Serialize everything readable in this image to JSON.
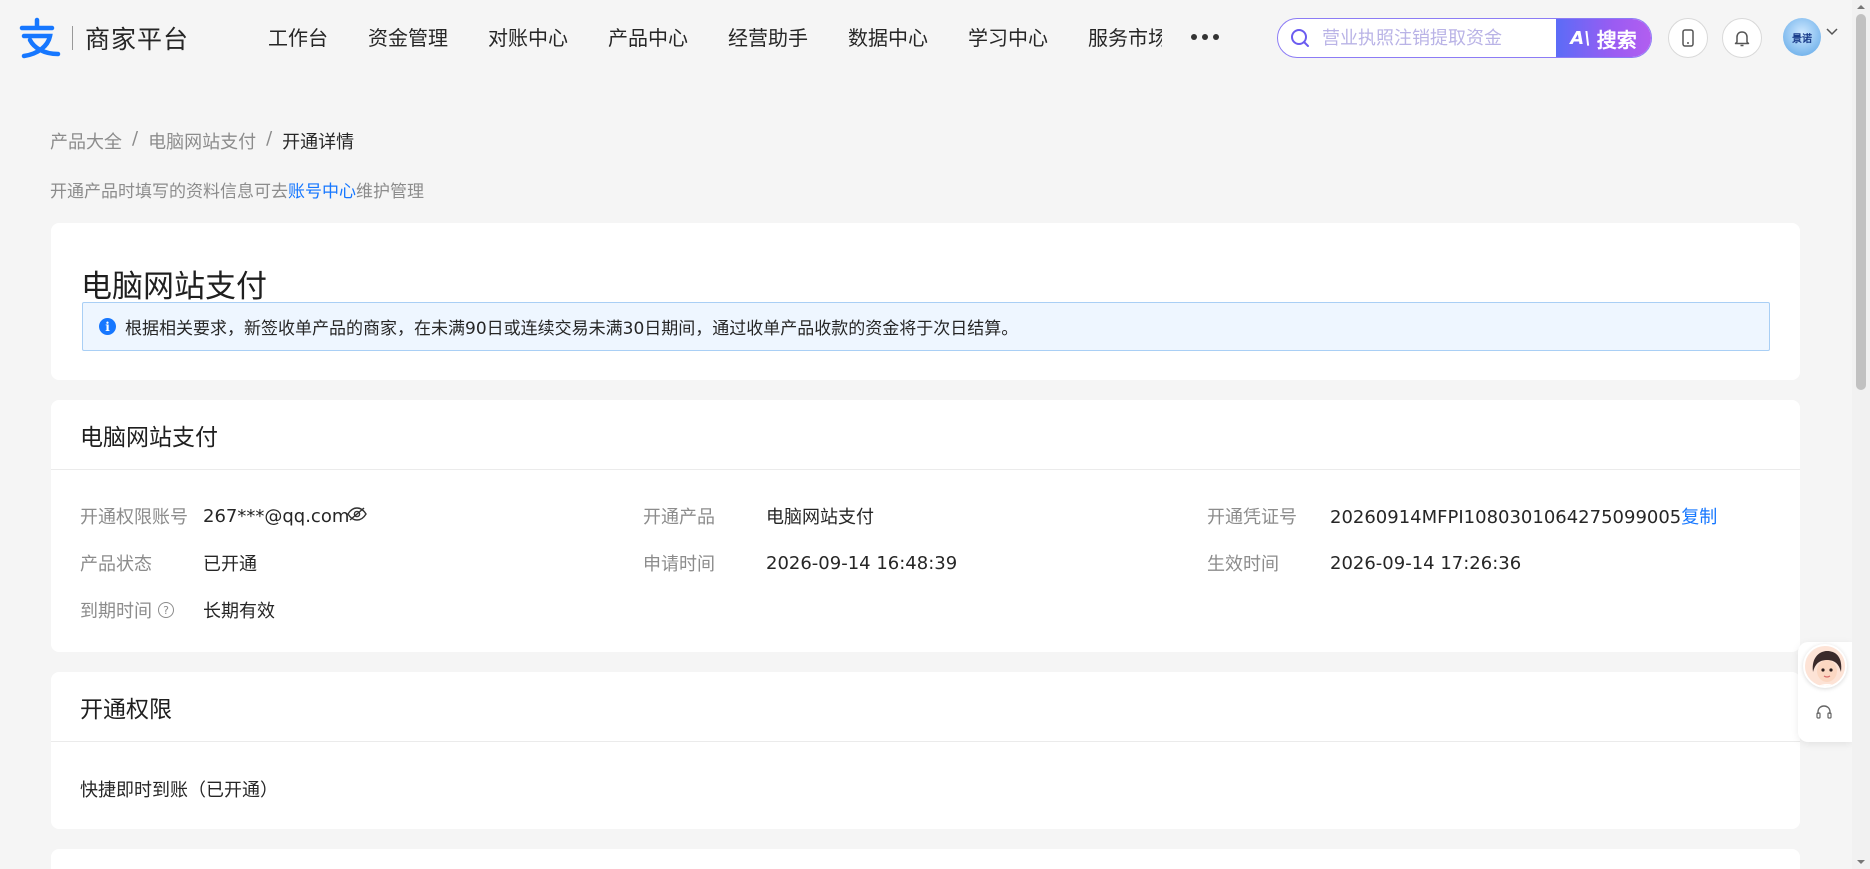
{
  "brand": {
    "name": "商家平台",
    "logo_icon": "alipay-logo-icon"
  },
  "nav": {
    "items": [
      "工作台",
      "资金管理",
      "对账中心",
      "产品中心",
      "经营助手",
      "数据中心",
      "学习中心",
      "服务市场"
    ],
    "more_icon": "more-dots-icon"
  },
  "search": {
    "placeholder": "营业执照注销提取资金",
    "button_label": "搜索",
    "button_badge": "A\\"
  },
  "header_icons": [
    "mobile-icon",
    "bell-icon"
  ],
  "user": {
    "avatar_text": "景诺"
  },
  "breadcrumb": {
    "items": [
      "产品大全",
      "电脑网站支付"
    ],
    "current": "开通详情",
    "separator": "/"
  },
  "hint": {
    "before": "开通产品时填写的资料信息可去",
    "link": "账号中心",
    "after": "维护管理"
  },
  "product_card": {
    "title": "电脑网站支付",
    "notice": "根据相关要求，新签收单产品的商家，在未满90日或连续交易未满30日期间，通过收单产品收款的资金将于次日结算。"
  },
  "detail_card": {
    "title": "电脑网站支付",
    "fields": {
      "account": {
        "label": "开通权限账号",
        "value": "267***@qq.com"
      },
      "product": {
        "label": "开通产品",
        "value": "电脑网站支付"
      },
      "voucher": {
        "label": "开通凭证号",
        "value": "20260914MFPI1080301064275099005",
        "action": "复制"
      },
      "status": {
        "label": "产品状态",
        "value": "已开通"
      },
      "apply_time": {
        "label": "申请时间",
        "value": "2026-09-14 16:48:39"
      },
      "effective_time": {
        "label": "生效时间",
        "value": "2026-09-14 17:26:36"
      },
      "expire_time": {
        "label": "到期时间",
        "value": "长期有效",
        "help": "?"
      }
    }
  },
  "permission_card": {
    "title": "开通权限",
    "item": "快捷即时到账（已开通）"
  },
  "colors": {
    "accent": "#1677ff",
    "search_gradient_start": "#5b6cf7",
    "search_gradient_end": "#b25ef0",
    "background": "#f5f5f5"
  }
}
